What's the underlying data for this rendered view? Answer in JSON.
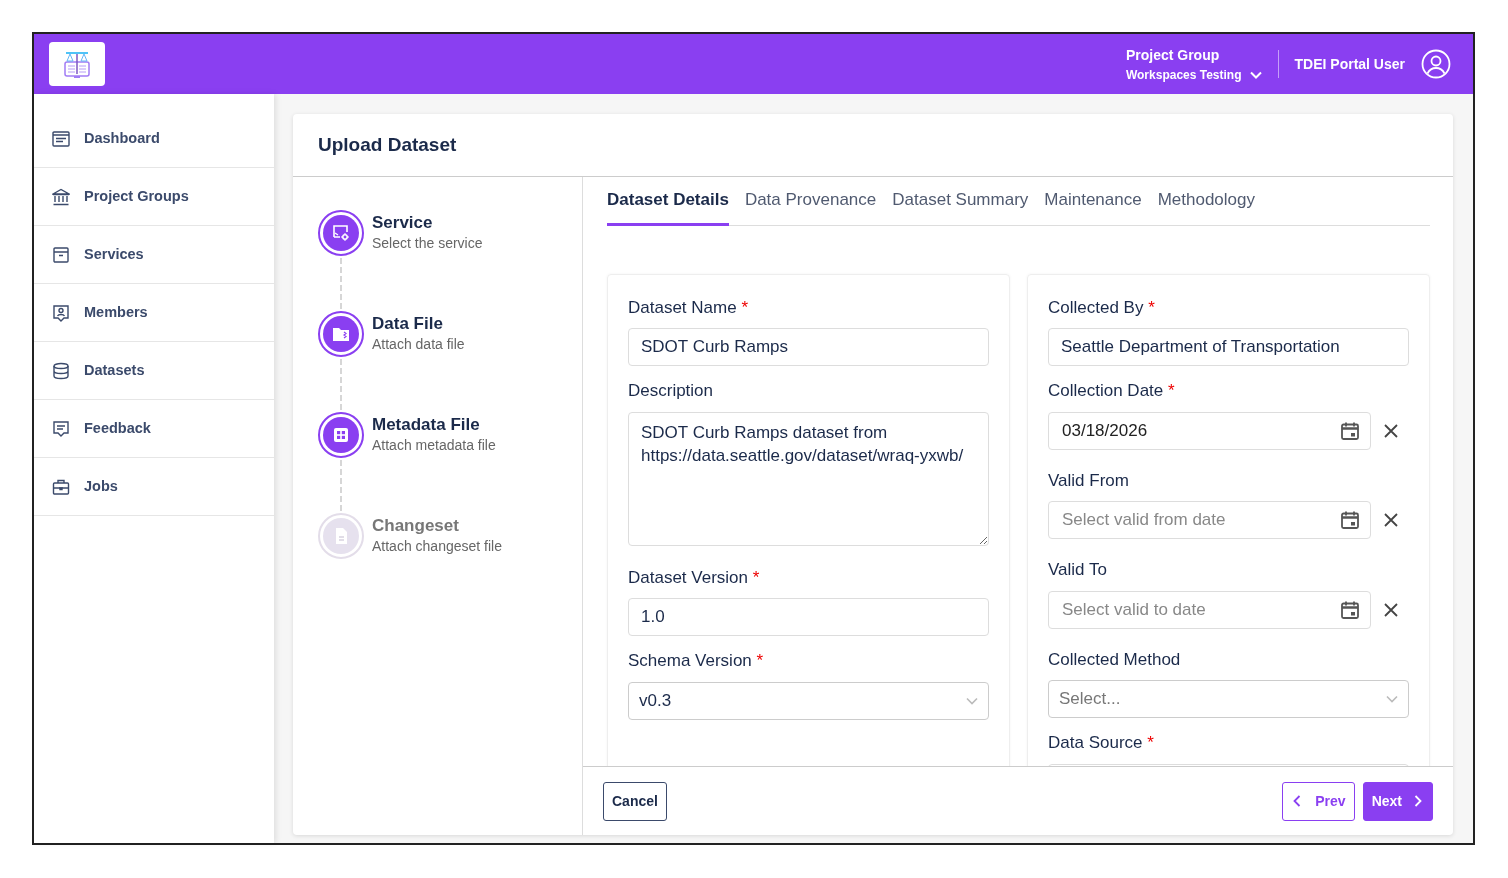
{
  "header": {
    "group_label": "Project Group",
    "group_name": "Workspaces Testing",
    "user": "TDEI Portal User"
  },
  "sidebar": {
    "items": [
      {
        "label": "Dashboard",
        "kind": "dashboard",
        "selected": false
      },
      {
        "label": "Project Groups",
        "kind": "bank",
        "selected": false
      },
      {
        "label": "Services",
        "kind": "archive",
        "selected": false
      },
      {
        "label": "Members",
        "kind": "members",
        "selected": false
      },
      {
        "label": "Datasets",
        "kind": "database",
        "selected": false
      },
      {
        "label": "Feedback",
        "kind": "feedback",
        "selected": false
      },
      {
        "label": "Jobs",
        "kind": "jobs",
        "selected": false
      }
    ]
  },
  "page": {
    "title": "Upload Dataset"
  },
  "steps": [
    {
      "title": "Service",
      "subtitle": "Select the service",
      "kind": "service",
      "active": true
    },
    {
      "title": "Data File",
      "subtitle": "Attach data file",
      "kind": "folder",
      "active": true
    },
    {
      "title": "Metadata File",
      "subtitle": "Attach metadata file",
      "kind": "grid",
      "active": true
    },
    {
      "title": "Changeset",
      "subtitle": "Attach changeset file",
      "kind": "document",
      "active": false
    }
  ],
  "tabs": [
    {
      "label": "Dataset Details",
      "selected": true
    },
    {
      "label": "Data Provenance",
      "selected": false
    },
    {
      "label": "Dataset Summary",
      "selected": false
    },
    {
      "label": "Maintenance",
      "selected": false
    },
    {
      "label": "Methodology",
      "selected": false
    }
  ],
  "form": {
    "left": [
      {
        "label": "Dataset Name",
        "required_mark": "*",
        "kind": "text",
        "value": "SDOT Curb Ramps"
      },
      {
        "label": "Description",
        "kind": "textarea",
        "value": "SDOT Curb Ramps dataset from https://data.seattle.gov/dataset/wraq-yxwb/"
      },
      {
        "label": "Dataset Version",
        "required_mark": "*",
        "kind": "text",
        "value": "1.0"
      },
      {
        "label": "Schema Version",
        "required_mark": "*",
        "kind": "select",
        "value": "v0.3"
      }
    ],
    "right": [
      {
        "label": "Collected By",
        "required_mark": "*",
        "kind": "text",
        "value": "Seattle Department of Transportation"
      },
      {
        "label": "Collection Date",
        "required_mark": "*",
        "kind": "date",
        "value": "03/18/2026"
      },
      {
        "label": "Valid From",
        "kind": "date",
        "placeholder": "Select valid from date"
      },
      {
        "label": "Valid To",
        "kind": "date",
        "placeholder": "Select valid to date"
      },
      {
        "label": "Collected Method",
        "kind": "select",
        "placeholder": "Select..."
      },
      {
        "label": "Data Source",
        "required_mark": "*",
        "kind": "text"
      }
    ]
  },
  "footer": {
    "buttons": [
      {
        "label": "Cancel",
        "kind": "cancel"
      },
      {
        "label": "Prev",
        "kind": "prev"
      },
      {
        "label": "Next",
        "kind": "next"
      }
    ]
  }
}
